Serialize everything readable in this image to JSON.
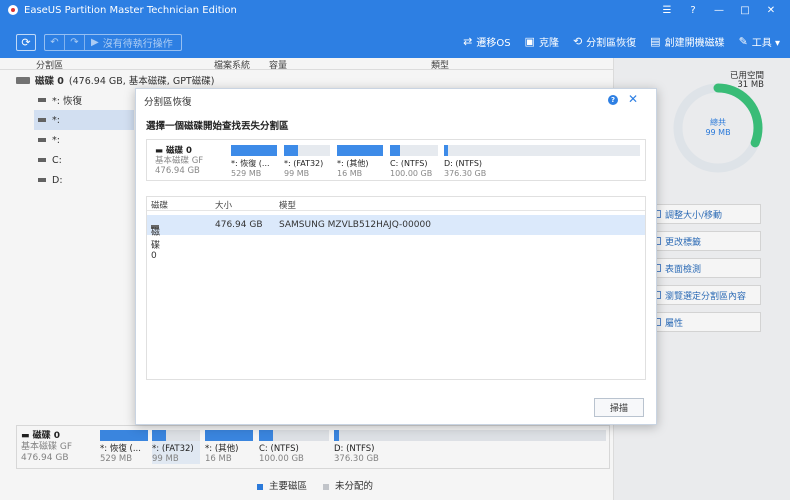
{
  "window": {
    "title": "EaseUS Partition Master Technician Edition",
    "controls": [
      "☰",
      "?",
      "—",
      "□",
      "✕"
    ]
  },
  "toolbar": {
    "refresh_icon": "⟳",
    "undo_icon": "↶",
    "redo_icon": "↷",
    "pending_icon": "▶",
    "pending_label": "沒有待執行操作",
    "actions": [
      {
        "icon": "⇄",
        "label": "遷移OS"
      },
      {
        "icon": "▣",
        "label": "克隆"
      },
      {
        "icon": "⟲",
        "label": "分割區恢復"
      },
      {
        "icon": "▤",
        "label": "創建開機磁碟"
      },
      {
        "icon": "✎",
        "label": "工具 ▾"
      }
    ]
  },
  "table_header": {
    "partition": "分割區",
    "filesystem": "檔案系統",
    "capacity": "容量",
    "type": "類型"
  },
  "disk_row": {
    "name": "磁碟 0",
    "detail": "(476.94 GB, 基本磁碟, GPT磁碟)"
  },
  "partitions": [
    {
      "label": "*: 恢復"
    },
    {
      "label": "*:"
    },
    {
      "label": "*:"
    },
    {
      "label": "C:"
    },
    {
      "label": "D:"
    }
  ],
  "bottom_map": {
    "disk_name": "磁碟 0",
    "disk_type": "基本磁碟 GF",
    "disk_size": "476.94 GB",
    "parts": [
      {
        "name": "*: 恢復 (...",
        "size": "529 MB",
        "fill": 1.0
      },
      {
        "name": "*: (FAT32)",
        "size": "99 MB",
        "fill": 0.3
      },
      {
        "name": "*: (其他)",
        "size": "16 MB",
        "fill": 1.0
      },
      {
        "name": "C: (NTFS)",
        "size": "100.00 GB",
        "fill": 0.2
      },
      {
        "name": "D: (NTFS)",
        "size": "376.30 GB",
        "fill": 0.01
      }
    ]
  },
  "legend": {
    "primary": "主要磁區",
    "unallocated": "未分配的",
    "primary_color": "#2d7fe3",
    "unallocated_color": "#c9cdd2"
  },
  "right_panel": {
    "used_label": "已用空間",
    "used_value": "31 MB",
    "total_label": "總共",
    "total_value": "99 MB",
    "used_fraction": 0.31,
    "operations": [
      "調整大小/移動",
      "更改標籤",
      "表面檢測",
      "瀏覽選定分割區內容",
      "屬性"
    ]
  },
  "dialog": {
    "title": "分割區恢復",
    "help_icon": "?",
    "close_icon": "✕",
    "heading": "選擇一個磁碟開始查找丟失分割區",
    "disk_name": "磁碟 0",
    "disk_type": "基本磁碟 GF",
    "disk_size": "476.94 GB",
    "parts": [
      {
        "name": "*: 恢復 (...",
        "size": "529 MB",
        "fill": 1.0
      },
      {
        "name": "*: (FAT32)",
        "size": "99 MB",
        "fill": 0.3
      },
      {
        "name": "*: (其他)",
        "size": "16 MB",
        "fill": 1.0
      },
      {
        "name": "C: (NTFS)",
        "size": "100.00 GB",
        "fill": 0.2
      },
      {
        "name": "D: (NTFS)",
        "size": "376.30 GB",
        "fill": 0.02
      }
    ],
    "table_headers": {
      "disk": "磁碟",
      "size": "大小",
      "model": "模型"
    },
    "rows": [
      {
        "disk": "磁碟 0",
        "size": "476.94 GB",
        "model": "SAMSUNG MZVLB512HAJQ-00000"
      }
    ],
    "scan_button": "掃描"
  }
}
